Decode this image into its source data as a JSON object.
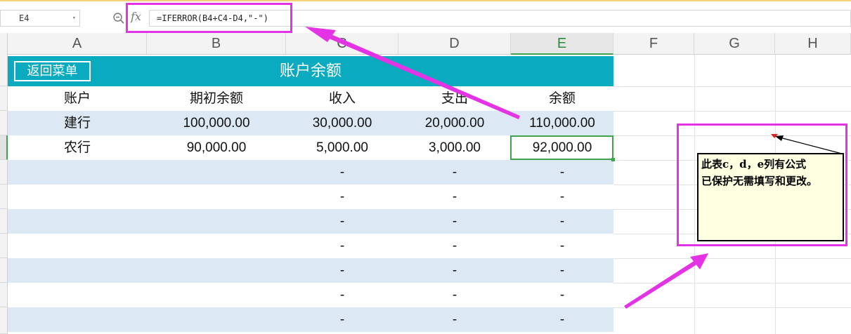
{
  "formula_bar": {
    "cell_ref": "E4",
    "dropdown_glyph": "▾",
    "fx_label": "fx",
    "formula": "=IFERROR(B4+C4-D4,\"-\")"
  },
  "columns": [
    "A",
    "B",
    "C",
    "D",
    "E",
    "F",
    "G",
    "H"
  ],
  "selected_column": "E",
  "sheet": {
    "back_button": "返回菜单",
    "title": "账户余额",
    "headers": [
      "账户",
      "期初余额",
      "收入",
      "支出",
      "余额"
    ],
    "rows": [
      [
        "建行",
        "100,000.00",
        "30,000.00",
        "20,000.00",
        "110,000.00"
      ],
      [
        "农行",
        "90,000.00",
        "5,000.00",
        "3,000.00",
        "92,000.00"
      ],
      [
        "",
        "",
        "-",
        "-",
        "-"
      ],
      [
        "",
        "",
        "-",
        "-",
        "-"
      ],
      [
        "",
        "",
        "-",
        "-",
        "-"
      ],
      [
        "",
        "",
        "-",
        "-",
        "-"
      ],
      [
        "",
        "",
        "-",
        "-",
        "-"
      ],
      [
        "",
        "",
        "-",
        "-",
        "-"
      ],
      [
        "",
        "",
        "-",
        "-",
        "-"
      ]
    ]
  },
  "comment": {
    "line1": "此表c，d，e列有公式",
    "line2": "已保护无需填写和更改。"
  },
  "colors": {
    "title_bg": "#0aaabf",
    "band_row": "#dce8f3",
    "annotation": "#e433e4",
    "selection": "#3fa34d",
    "comment_bg": "#ffffe1"
  },
  "icons": [
    "zoom-out-icon",
    "fx-icon",
    "dropdown-chevron-icon",
    "comment-indicator-icon"
  ]
}
